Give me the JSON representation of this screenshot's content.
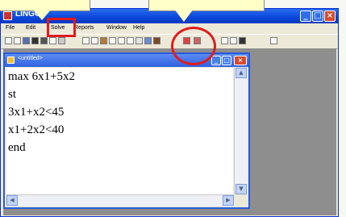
{
  "app": {
    "title": "LINGO",
    "window_buttons": {
      "minimize": "_",
      "maximize": "□",
      "close": "×"
    }
  },
  "menubar": {
    "items": [
      {
        "label": "File"
      },
      {
        "label": "Edit"
      },
      {
        "label": "Solve"
      },
      {
        "label": "Reports"
      },
      {
        "label": "Window"
      },
      {
        "label": "Help"
      }
    ]
  },
  "toolbar": {
    "tools": [
      "new-icon",
      "open-icon",
      "save-icon",
      "print-icon",
      "cut-icon",
      "copy-icon",
      "paste-icon",
      "undo-icon",
      "redo-icon",
      "find-icon",
      "goto-icon",
      "match-paren-icon",
      "solve-icon",
      "stop-icon",
      "options-icon",
      "window-icon",
      "tile-icon",
      "cascade-icon",
      "send-to-back-icon",
      "close-all-icon",
      "help-icon",
      "context-help-icon"
    ]
  },
  "child_window": {
    "title": "<untitled>",
    "buttons": {
      "minimize": "_",
      "maximize": "□",
      "close": "×"
    },
    "editor_lines": [
      "max 6x1+5x2",
      "st",
      "3x1+x2<45",
      "x1+2x2<40",
      "end"
    ]
  },
  "annotations": {
    "colors": {
      "highlight": "#e21b1b",
      "callout": "#ffffc8"
    }
  }
}
